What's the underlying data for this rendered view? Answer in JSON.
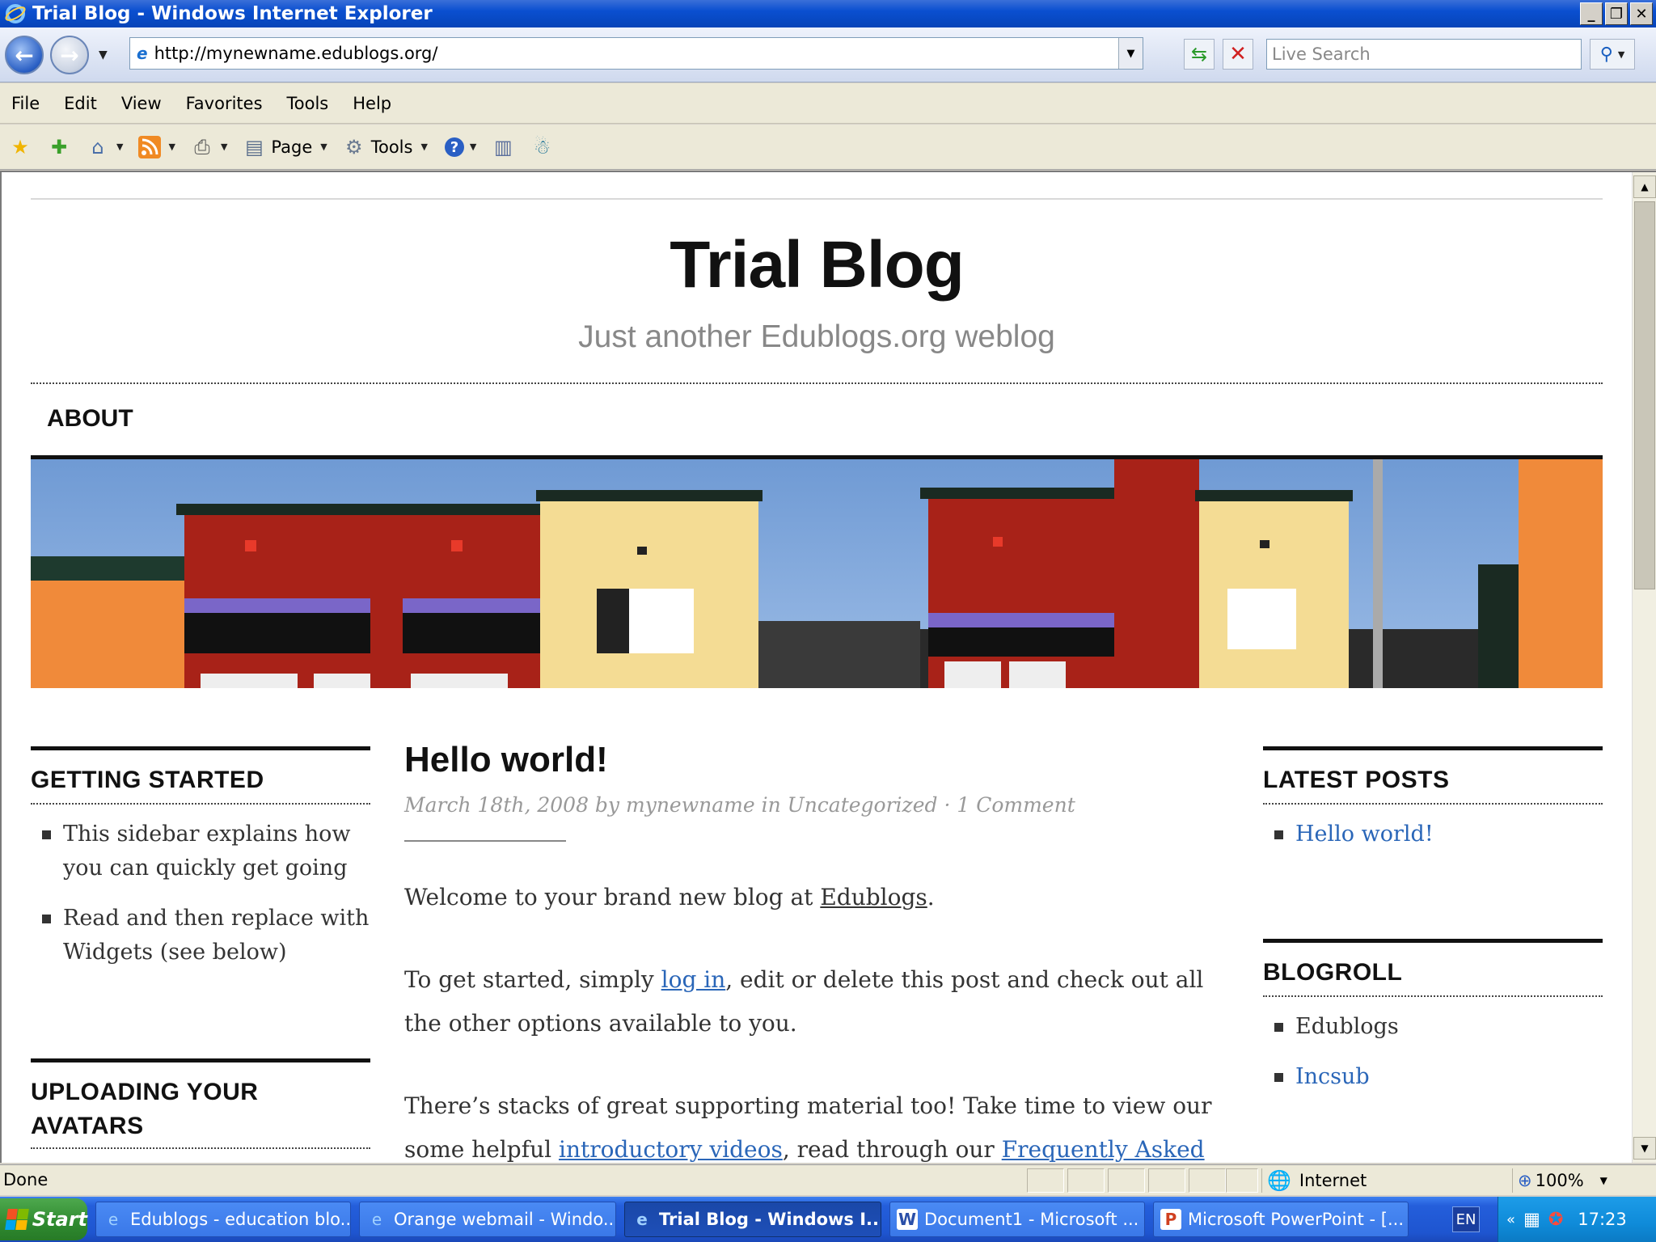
{
  "window": {
    "title": "Trial Blog - Windows Internet Explorer"
  },
  "address": {
    "url": "http://mynewname.edublogs.org/",
    "search_placeholder": "Live Search"
  },
  "menu": [
    "File",
    "Edit",
    "View",
    "Favorites",
    "Tools",
    "Help"
  ],
  "commandbar": {
    "page_label": "Page",
    "tools_label": "Tools"
  },
  "blog": {
    "title": "Trial Blog",
    "tagline": "Just another Edublogs.org weblog",
    "nav_about": "ABOUT"
  },
  "left_sidebar": {
    "getting_started": {
      "heading": "GETTING STARTED",
      "items": [
        "This sidebar explains how you can quickly get going",
        "Read and then replace with Widgets (see below)"
      ]
    },
    "uploading": {
      "heading": "UPLOADING YOUR AVATARS"
    }
  },
  "post": {
    "title": "Hello world!",
    "meta": "March 18th, 2008 by mynewname in Uncategorized · 1 Comment",
    "p1_prefix": "Welcome to your brand new blog at ",
    "p1_link": "Edublogs",
    "p1_suffix": ".",
    "p2_prefix": "To get started, simply ",
    "p2_link": "log in",
    "p2_suffix": ", edit or delete this post and check out all the other options available to you.",
    "p3_prefix": "There’s stacks of great supporting material too! Take time to view our some helpful ",
    "p3_link1": "introductory videos",
    "p3_mid": ", read through our ",
    "p3_link2": "Frequently Asked"
  },
  "right_sidebar": {
    "latest_posts": {
      "heading": "LATEST POSTS",
      "items": [
        "Hello world!"
      ]
    },
    "blogroll": {
      "heading": "BLOGROLL",
      "items": [
        "Edublogs",
        "Incsub"
      ]
    }
  },
  "status": {
    "text": "Done",
    "zone": "Internet",
    "zoom": "100%"
  },
  "taskbar": {
    "start": "Start",
    "tasks": [
      "Edublogs - education blo...",
      "Orange webmail - Windo...",
      "Trial Blog - Windows I...",
      "Document1 - Microsoft ...",
      "Microsoft PowerPoint - [..."
    ],
    "lang": "EN",
    "clock": "17:23"
  },
  "colors": {
    "link": "#2a66b8",
    "title_bar": "#0a4fd0",
    "taskbar": "#245edb"
  }
}
